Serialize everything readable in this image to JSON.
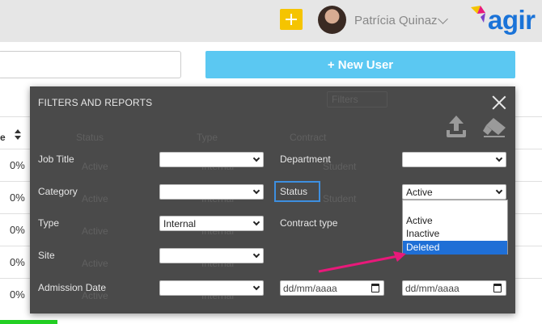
{
  "header": {
    "user_name": "Patrícia Quinaz",
    "logo_text": "agir",
    "icons": {
      "add": "plus-icon",
      "user_menu": "chevron-down-icon"
    }
  },
  "toolbar": {
    "search": {
      "value": "",
      "placeholder": ""
    },
    "new_user_label": "+ New User",
    "new_user_color": "#5bc8f2"
  },
  "table": {
    "header_partial": "e",
    "rows": [
      {
        "progress": "0%"
      },
      {
        "progress": "0%"
      },
      {
        "progress": "0%"
      },
      {
        "progress": "0%"
      },
      {
        "progress": "0%"
      }
    ]
  },
  "modal": {
    "title": "FILTERS AND REPORTS",
    "background_columns": {
      "filter": "Filters",
      "status": "Status",
      "type": "Type",
      "contract": "Contract"
    },
    "background_cells": [
      "Active",
      "Internal",
      "Active",
      "Internal",
      "Student",
      "Active",
      "Internal",
      "Active",
      "Internal",
      "Active",
      "Internal",
      "Student"
    ],
    "fields": {
      "job_title": {
        "label": "Job Title",
        "value": ""
      },
      "department": {
        "label": "Department",
        "value": ""
      },
      "category": {
        "label": "Category",
        "value": ""
      },
      "status": {
        "label": "Status",
        "value": "Active",
        "options": [
          "Active",
          "Inactive",
          "Deleted"
        ],
        "highlighted": "Deleted"
      },
      "type": {
        "label": "Type",
        "value": "Internal"
      },
      "contract_type": {
        "label": "Contract type"
      },
      "site": {
        "label": "Site",
        "value": ""
      },
      "admission_date": {
        "label": "Admission Date",
        "value": "",
        "date_from_placeholder": "dd/mm/aaaa",
        "date_to_placeholder": "dd/mm/aaaa"
      }
    },
    "icons": {
      "close": "close-icon",
      "export": "upload-icon",
      "clear": "eraser-icon"
    },
    "colors": {
      "panel": "#4a4a4a",
      "status_highlight": "#3d8fe0",
      "option_selected": "#1f6fd6",
      "annotation_arrow": "#e8197a"
    }
  }
}
